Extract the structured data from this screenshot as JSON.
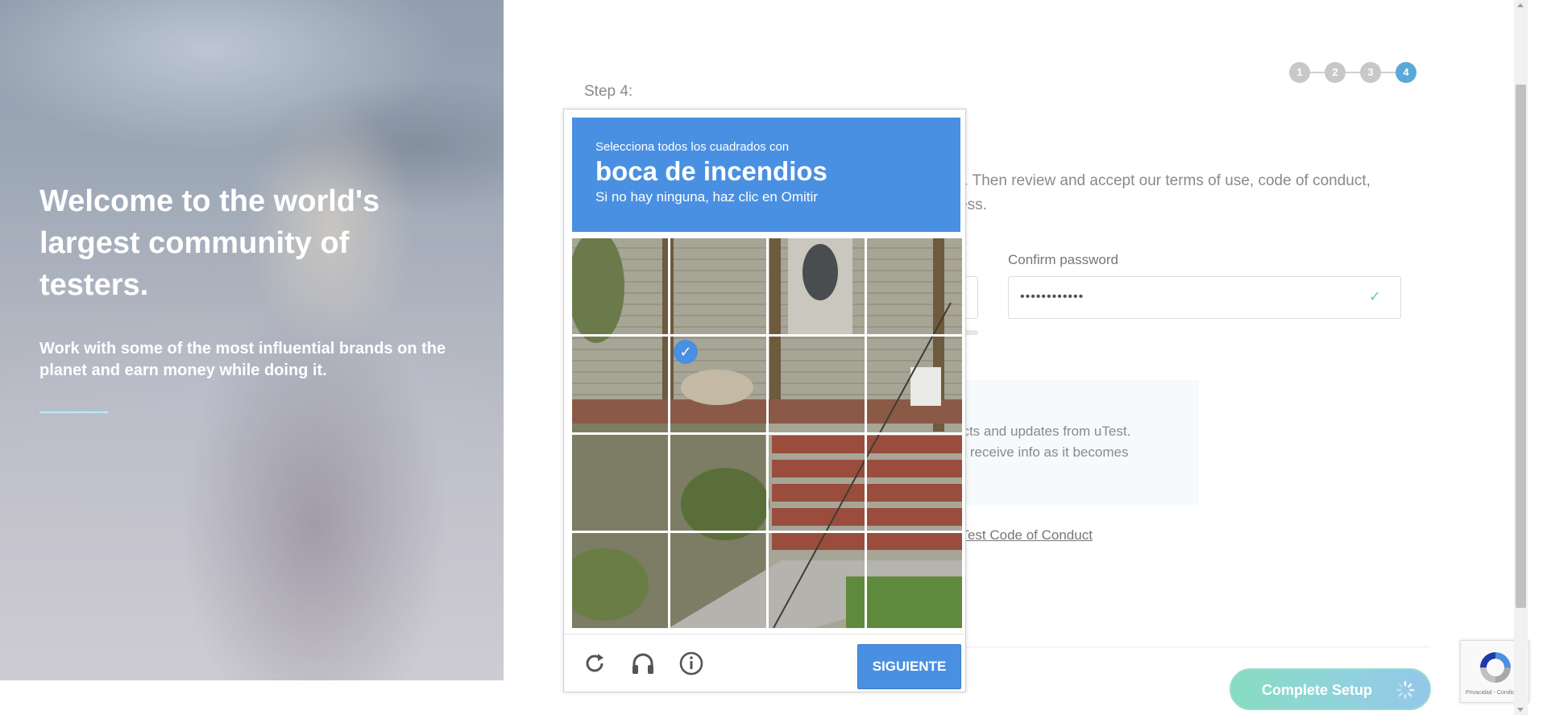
{
  "hero": {
    "title": "Welcome to the world's largest community of testers.",
    "subtitle": "Work with some of the most influential brands on the planet and earn money while doing it."
  },
  "steps": [
    "1",
    "2",
    "3",
    "4"
  ],
  "active_step": 4,
  "form": {
    "step_label": "Step 4:",
    "intro_line1": "unt. Then review and accept our terms of use, code of conduct,",
    "intro_line2": "ocess.",
    "confirm_password_label": "Confirm password",
    "confirm_password_value": "••••••••••••",
    "newsletter_line1": "ects and updates from uTest.",
    "newsletter_line2": "to receive info as it becomes",
    "conduct_prefix": "e ",
    "conduct_link": "uTest Code of Conduct",
    "complete_button": "Complete Setup"
  },
  "captcha": {
    "instruction": "Selecciona todos los cuadrados con",
    "target": "boca de incendios",
    "skip_hint": "Si no hay ninguna, haz clic en Omitir",
    "grid_rows": 4,
    "grid_cols": 4,
    "selected_tiles": [
      5
    ],
    "next_button": "SIGUIENTE",
    "reload_icon": "reload-icon",
    "audio_icon": "headphones-icon",
    "info_icon": "info-icon"
  },
  "recaptcha_badge": {
    "footer": "Privacidad - Condiciones"
  },
  "colors": {
    "captcha_blue": "#4a90e2",
    "step_active": "#5aa9d6",
    "step_inactive": "#c8c8c8",
    "check_green": "#6bcf9a"
  }
}
